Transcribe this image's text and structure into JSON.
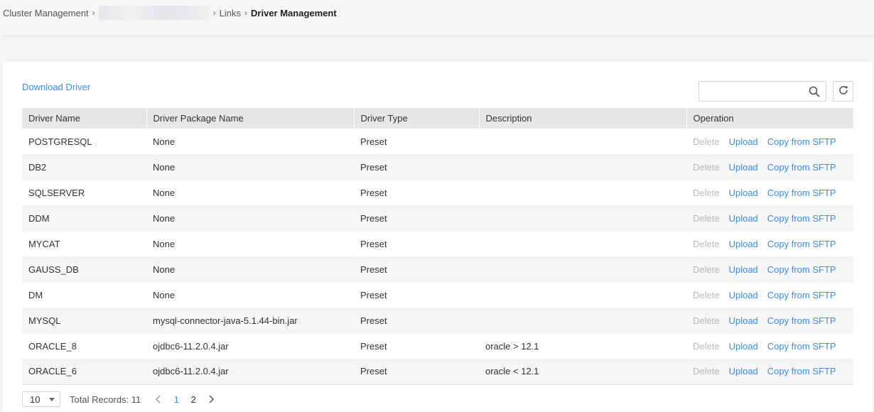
{
  "breadcrumb": {
    "items": [
      "Cluster Management",
      "Links"
    ],
    "current": "Driver Management"
  },
  "toolbar": {
    "download_label": "Download Driver",
    "search_placeholder": ""
  },
  "table": {
    "columns": [
      "Driver Name",
      "Driver Package Name",
      "Driver Type",
      "Description",
      "Operation"
    ],
    "rows": [
      {
        "name": "POSTGRESQL",
        "package": "None",
        "type": "Preset",
        "description": ""
      },
      {
        "name": "DB2",
        "package": "None",
        "type": "Preset",
        "description": ""
      },
      {
        "name": "SQLSERVER",
        "package": "None",
        "type": "Preset",
        "description": ""
      },
      {
        "name": "DDM",
        "package": "None",
        "type": "Preset",
        "description": ""
      },
      {
        "name": "MYCAT",
        "package": "None",
        "type": "Preset",
        "description": ""
      },
      {
        "name": "GAUSS_DB",
        "package": "None",
        "type": "Preset",
        "description": ""
      },
      {
        "name": "DM",
        "package": "None",
        "type": "Preset",
        "description": ""
      },
      {
        "name": "MYSQL",
        "package": "mysql-connector-java-5.1.44-bin.jar",
        "type": "Preset",
        "description": ""
      },
      {
        "name": "ORACLE_8",
        "package": "ojdbc6-11.2.0.4.jar",
        "type": "Preset",
        "description": "oracle > 12.1"
      },
      {
        "name": "ORACLE_6",
        "package": "ojdbc6-11.2.0.4.jar",
        "type": "Preset",
        "description": "oracle < 12.1"
      }
    ],
    "operations": {
      "delete": "Delete",
      "upload": "Upload",
      "copy": "Copy from SFTP"
    }
  },
  "pagination": {
    "page_size": "10",
    "total_label": "Total Records: 11",
    "pages": [
      "1",
      "2"
    ],
    "current_page": "1"
  },
  "colors": {
    "link": "#3a8ee6",
    "disabled": "#b7b9be",
    "header_bg": "#e6e7e9"
  },
  "icons": {
    "search": "search-icon",
    "refresh": "refresh-icon",
    "prev": "chevron-left-icon",
    "next": "chevron-right-icon",
    "dropdown": "caret-down-icon"
  }
}
